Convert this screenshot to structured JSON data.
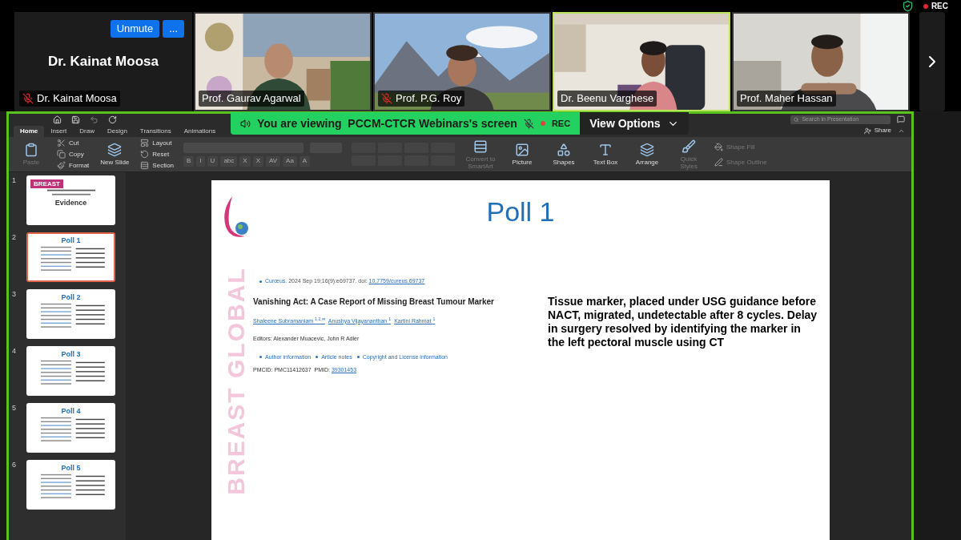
{
  "top_bar": {
    "recording": "REC"
  },
  "participants": [
    {
      "kind": "name",
      "name": "Dr. Kainat Moosa",
      "muted": true,
      "speaking": false,
      "display_name": "Dr. Kainat Moosa",
      "buttons": [
        "Unmute",
        "..."
      ]
    },
    {
      "kind": "picture",
      "name": "Prof. Gaurav Agarwal",
      "muted": false,
      "speaking": false
    },
    {
      "kind": "picture",
      "name": "Prof. P.G. Roy",
      "muted": true,
      "speaking": false
    },
    {
      "kind": "picture",
      "name": "Dr. Beenu Varghese",
      "muted": false,
      "speaking": true
    },
    {
      "kind": "picture",
      "name": "Prof. Maher Hassan",
      "muted": false,
      "speaking": false
    }
  ],
  "share_banner": {
    "text": "You are viewing  PCCM-CTCR Webinars's screen",
    "recording": "REC",
    "view_options": "View Options"
  },
  "app": {
    "search": {
      "placeholder": "Search in Presentation"
    },
    "share": "Share",
    "tabs": [
      {
        "label": "Home",
        "selected": true
      },
      {
        "label": "Insert",
        "selected": false
      },
      {
        "label": "Draw",
        "selected": false
      },
      {
        "label": "Design",
        "selected": false
      },
      {
        "label": "Transitions",
        "selected": false
      },
      {
        "label": "Animations",
        "selected": false
      }
    ],
    "clipboard": {
      "paste": "Paste",
      "items": [
        "Cut",
        "Copy",
        "Format"
      ]
    },
    "slides_group": {
      "new_slide": "New Slide",
      "items": [
        "Layout",
        "Reset",
        "Section"
      ]
    },
    "format_buttons": [
      "B",
      "I",
      "U",
      "abc",
      "X",
      "X",
      "AV",
      "Aa",
      "A"
    ],
    "insert_buttons": [
      "Convert to SmartArt",
      "Picture",
      "Shapes",
      "Text Box",
      "Arrange",
      "Quick Styles"
    ],
    "shape_buttons": [
      "Shape Fill",
      "Shape Outline"
    ]
  },
  "thumbnails": [
    {
      "number": "1",
      "title": "BREAST",
      "subtitle": "Evidence",
      "selected": false
    },
    {
      "number": "2",
      "title": "Poll 1",
      "selected": true
    },
    {
      "number": "3",
      "title": "Poll 2",
      "selected": false
    },
    {
      "number": "4",
      "title": "Poll 3",
      "selected": false
    },
    {
      "number": "5",
      "title": "Poll 4",
      "selected": false
    },
    {
      "number": "6",
      "title": "Poll 5",
      "selected": false
    }
  ],
  "slide": {
    "title": "Poll 1",
    "side_text": "BREAST GLOBAL",
    "citation": {
      "journal": "Curœus.",
      "text": " 2024 Sep 19;16(9):e69737. doi: ",
      "doi": "10.7759/cureus.69737"
    },
    "article_title": "Vanishing Act: A Case Report of Missing Breast Tumour Marker",
    "authors": [
      "Shaleene Subramaniam $^{1,2,✉}$",
      "Anushya Vijayananthan $^{1}$",
      "Kartini Rahmat $^{1}$"
    ],
    "editors": "Editors: Alexander Muacevic, John R Adler",
    "info_links": [
      "Author information",
      "Article notes",
      "Copyright and License information"
    ],
    "ids": "PMCID: PMC11412637  PMID: ",
    "pmid": "39301453",
    "note": "Tissue marker, placed under USG guidance before NACT, migrated, undetectable after 8 cycles. Delay in surgery resolved by identifying the marker in the left pectoral muscle using CT"
  }
}
